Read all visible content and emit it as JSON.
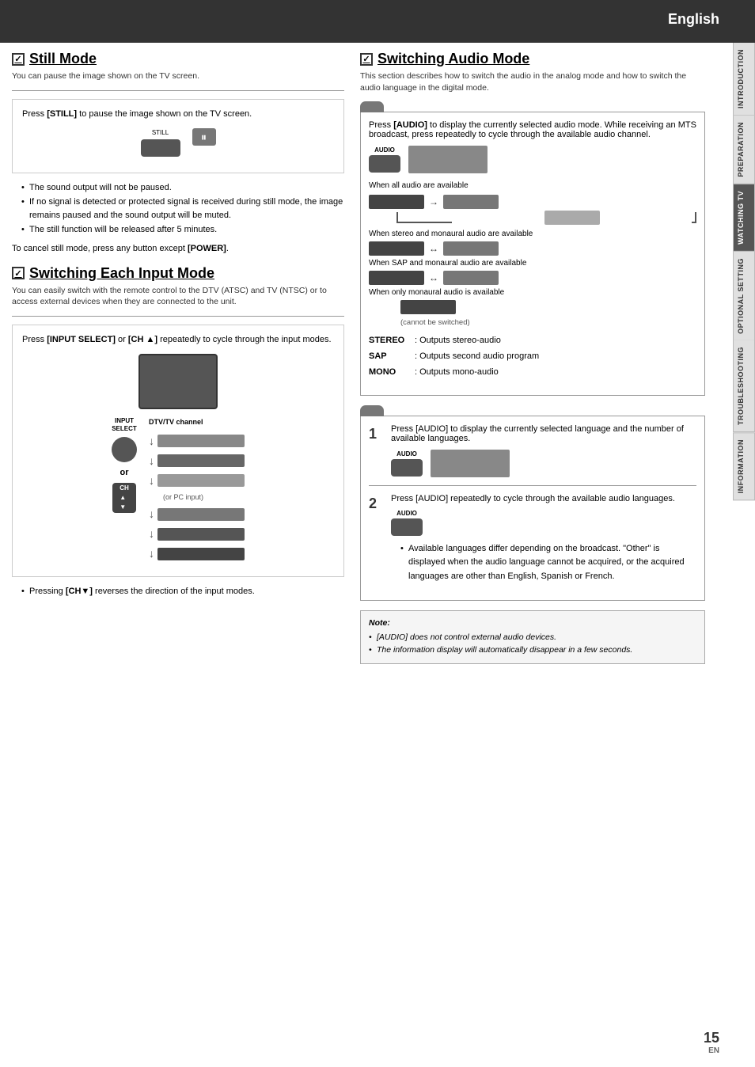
{
  "header": {
    "title": "English"
  },
  "sidetabs": [
    {
      "label": "INTRODUCTION",
      "active": false
    },
    {
      "label": "PREPARATION",
      "active": false
    },
    {
      "label": "WATCHING TV",
      "active": true
    },
    {
      "label": "OPTIONAL SETTING",
      "active": false
    },
    {
      "label": "TROUBLESHOOTING",
      "active": false
    },
    {
      "label": "INFORMATION",
      "active": false
    }
  ],
  "still_mode": {
    "title": "Still Mode",
    "description": "You can pause the image shown on the TV screen.",
    "instruction": "Press [STILL] to pause the image shown on the TV screen.",
    "button_label": "STILL",
    "bullets": [
      "The sound output will not be paused.",
      "If no signal is detected or protected signal is received during still mode, the image remains paused and the sound output will be muted.",
      "The still function will be released after 5 minutes."
    ],
    "cancel_text": "To cancel still mode, press any button except [POWER]."
  },
  "switching_input": {
    "title": "Switching Each Input Mode",
    "description": "You can easily switch with the remote control to the DTV (ATSC) and TV (NTSC) or to access external devices when they are connected to the unit.",
    "instruction": "Press [INPUT SELECT] or [CH ▲] repeatedly to cycle through the input modes.",
    "input_select_label": "INPUT\nSELECT",
    "or_text": "or",
    "channel_label": "DTV/TV channel",
    "or_pc_text": "(or PC input)",
    "bullet": "Pressing [CH▼] reverses the direction of the input modes."
  },
  "switching_audio": {
    "title": "Switching Audio Mode",
    "description": "This section describes how to switch the audio in the analog mode and how to switch the audio language in the digital mode.",
    "analog": {
      "instruction": "Press [AUDIO] to display the currently selected audio mode. While receiving an MTS broadcast, press repeatedly to cycle through the available audio channel.",
      "button_label": "AUDIO",
      "when_all_available": "When all audio are available",
      "when_stereo_mono": "When stereo and monaural audio are available",
      "when_sap_mono": "When SAP and monaural audio are available",
      "when_only_mono": "When only monaural audio is available",
      "cannot_switch": "(cannot be switched)",
      "stereo_label": "STEREO",
      "stereo_desc": ": Outputs stereo-audio",
      "sap_label": "SAP",
      "sap_desc": ": Outputs second audio program",
      "mono_label": "MONO",
      "mono_desc": ": Outputs mono-audio"
    },
    "digital": {
      "step1": "Press [AUDIO] to display the currently selected language and the number of available languages.",
      "step2": "Press [AUDIO] repeatedly to cycle through the available audio languages.",
      "button_label": "AUDIO",
      "bullet": "Available languages differ depending on the broadcast. \"Other\" is displayed when the audio language cannot be acquired, or the acquired languages are other than English, Spanish or French."
    },
    "note": {
      "title": "Note:",
      "items": [
        "[AUDIO] does not control external audio devices.",
        "The information display will automatically disappear in a few seconds."
      ]
    }
  },
  "page_number": "15",
  "page_en": "EN"
}
